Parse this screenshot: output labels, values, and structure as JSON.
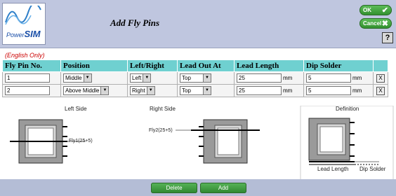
{
  "header": {
    "logo_text_power": "Power",
    "logo_text_sim": "SIM",
    "title": "Add Fly Pins",
    "ok_label": "OK",
    "cancel_label": "Cancel",
    "help_label": "?"
  },
  "note": "(English Only)",
  "table": {
    "columns": [
      "Fly Pin No.",
      "Position",
      "Left/Right",
      "Lead Out At",
      "Lead Length",
      "Dip Solder"
    ],
    "rows": [
      {
        "pin_no": "1",
        "position": "Middle",
        "side": "Left",
        "lead_out": "Top",
        "lead_length": "25",
        "lead_unit": "mm",
        "dip_solder": "5",
        "dip_unit": "mm",
        "delete": "X"
      },
      {
        "pin_no": "2",
        "position": "Above Middle",
        "side": "Right",
        "lead_out": "Top",
        "lead_length": "25",
        "lead_unit": "mm",
        "dip_solder": "5",
        "dip_unit": "mm",
        "delete": "X"
      }
    ]
  },
  "diagrams": {
    "left_caption": "Left Side",
    "right_caption": "Right Side",
    "definition_caption": "Definition",
    "fly1_label": "Fly1(25+5)",
    "fly2_label": "Fly2(25+5)",
    "lead_length_label": "Lead Length",
    "dip_solder_label": "Dip Solder"
  },
  "footer": {
    "delete_label": "Delete",
    "add_label": "Add"
  }
}
